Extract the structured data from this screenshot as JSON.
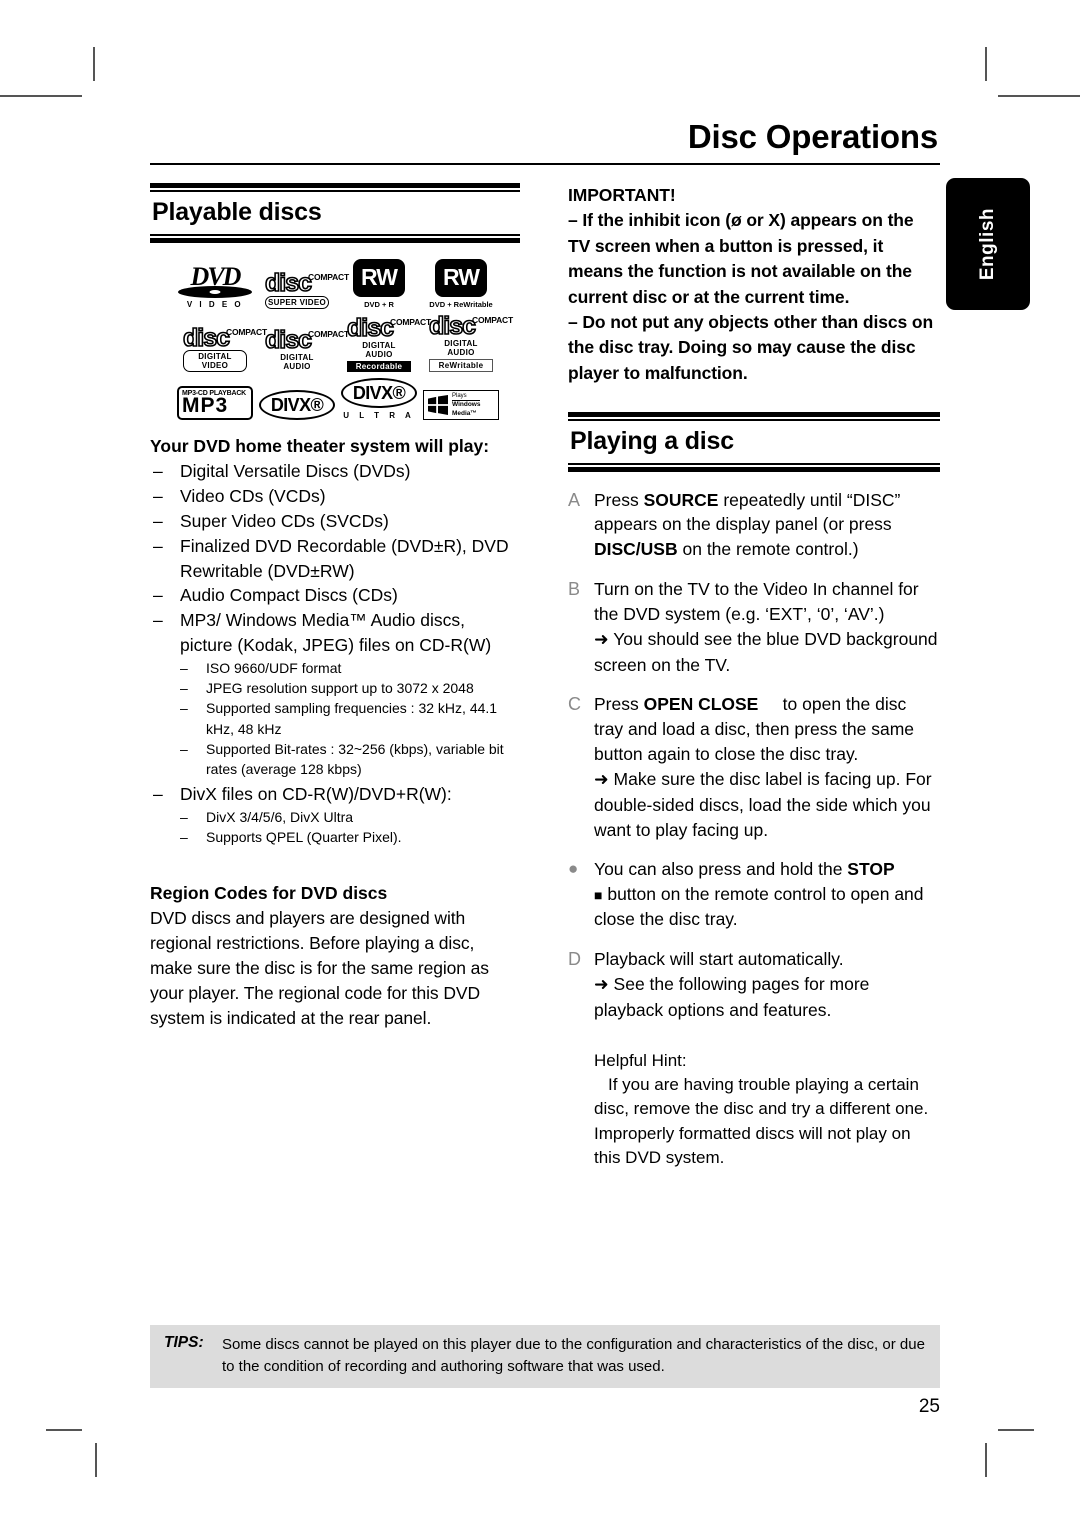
{
  "document": {
    "title": "Disc Operations",
    "page_number": "25",
    "language_tab": "English"
  },
  "left_column": {
    "section_title": "Playable discs",
    "logos": [
      {
        "name": "dvd-video-logo",
        "word": "DVD",
        "caption": "V I D E O"
      },
      {
        "name": "compact-disc-super-video-logo",
        "top": "COMPACT",
        "word": "disc",
        "band": "SUPER  VIDEO"
      },
      {
        "name": "dvd-plus-r-logo",
        "word": "RW",
        "caption": "DVD + R"
      },
      {
        "name": "dvd-plus-rewritable-logo",
        "word": "RW",
        "caption": "DVD + ReWritable"
      },
      {
        "name": "compact-disc-digital-video-logo",
        "top": "COMPACT",
        "word": "disc",
        "band": "DIGITAL VIDEO"
      },
      {
        "name": "compact-disc-digital-audio-logo",
        "top": "COMPACT",
        "word": "disc",
        "band": "DIGITAL AUDIO"
      },
      {
        "name": "compact-disc-recordable-logo",
        "top": "COMPACT",
        "word": "disc",
        "band": "DIGITAL AUDIO",
        "band2": "Recordable"
      },
      {
        "name": "compact-disc-rewritable-logo",
        "top": "COMPACT",
        "word": "disc",
        "band": "DIGITAL AUDIO",
        "band2": "ReWritable"
      },
      {
        "name": "mp3-cd-playback-logo",
        "top": "MP3-CD PLAYBACK",
        "word": "MP3"
      },
      {
        "name": "divx-logo",
        "word": "DIVX®"
      },
      {
        "name": "divx-ultra-logo",
        "word": "DIVX®",
        "caption": "U L T R A"
      },
      {
        "name": "windows-media-logo",
        "line1": "Plays",
        "line2": "Windows",
        "line3": "Media™"
      }
    ],
    "subheading": "Your DVD home theater system will play:",
    "play_list": [
      "Digital Versatile Discs (DVDs)",
      "Video CDs (VCDs)",
      "Super Video CDs (SVCDs)",
      "Finalized DVD Recordable (DVD±R), DVD Rewritable (DVD±RW)",
      "Audio Compact Discs (CDs)",
      "MP3/ Windows Media™ Audio discs, picture (Kodak, JPEG) files on CD-R(W)"
    ],
    "mp3_sublist": [
      "ISO 9660/UDF format",
      "JPEG resolution support up to 3072 x 2048",
      "Supported sampling frequencies : 32 kHz, 44.1 kHz, 48 kHz",
      "Supported Bit-rates : 32~256 (kbps), variable bit rates (average 128 kbps)"
    ],
    "divx_item": "DivX files on CD-R(W)/DVD+R(W):",
    "divx_sublist": [
      "DivX 3/4/5/6, DivX Ultra",
      "Supports QPEL (Quarter Pixel)."
    ],
    "region_heading": "Region Codes for DVD discs",
    "region_body": "DVD discs and players are designed with regional restrictions. Before playing a disc, make sure the disc is for the same region as your player.  The regional code for this DVD system is indicated at the rear panel."
  },
  "right_column": {
    "important_heading": "IMPORTANT!",
    "important_items": [
      "– If the inhibit icon (ø or X) appears on the TV screen when a button is pressed, it means the function is not available on the current disc or at the current time.",
      "– Do not put any objects other than discs on the disc tray.  Doing so may cause the disc player to malfunction."
    ],
    "section_title": "Playing a disc",
    "steps": [
      {
        "marker": "A",
        "html": "Press <b>SOURCE</b> repeatedly until “DISC” appears on the display panel (or press <b>DISC/USB</b> on the remote control.)"
      },
      {
        "marker": "B",
        "html": "Turn on the TV to the Video In channel for the DVD system (e.g. ‘EXT’, ‘0’, ‘AV’.)<br><span class=\"arrow\">➜</span> You should see the blue DVD background screen on the TV."
      },
      {
        "marker": "C",
        "html": "Press <b>OPEN CLOSE</b> &nbsp;&nbsp;&nbsp;&nbsp;to open the disc tray and load a disc, then press the same button again to close the disc tray.<br><span class=\"arrow\">➜</span> Make sure the disc label is facing up. For double-sided discs, load the side which you want to play facing up."
      },
      {
        "marker": "●",
        "html": "You can also press and hold the <b>STOP</b><br><span class=\"stopsq\">■</span> button on the remote control to open and close the disc tray."
      },
      {
        "marker": "D",
        "html": "Playback will start automatically.<br><span class=\"arrow\">➜</span> See the following pages for more playback options and features."
      }
    ],
    "hint_label": "Helpful Hint:",
    "hint_body": "If you are having trouble playing a certain disc, remove the disc and try a different one. Improperly formatted discs will not play on this DVD system."
  },
  "footer": {
    "tips_label": "TIPS:",
    "tips_text": "Some discs cannot be played on this player due to the configuration and characteristics of the disc, or due to the condition of recording and authoring software that was used."
  },
  "colors": {
    "ink": "#000000",
    "marker_gray": "#8a8a8a",
    "tips_background": "#dcdcdc",
    "crop_mark": "#555555"
  }
}
